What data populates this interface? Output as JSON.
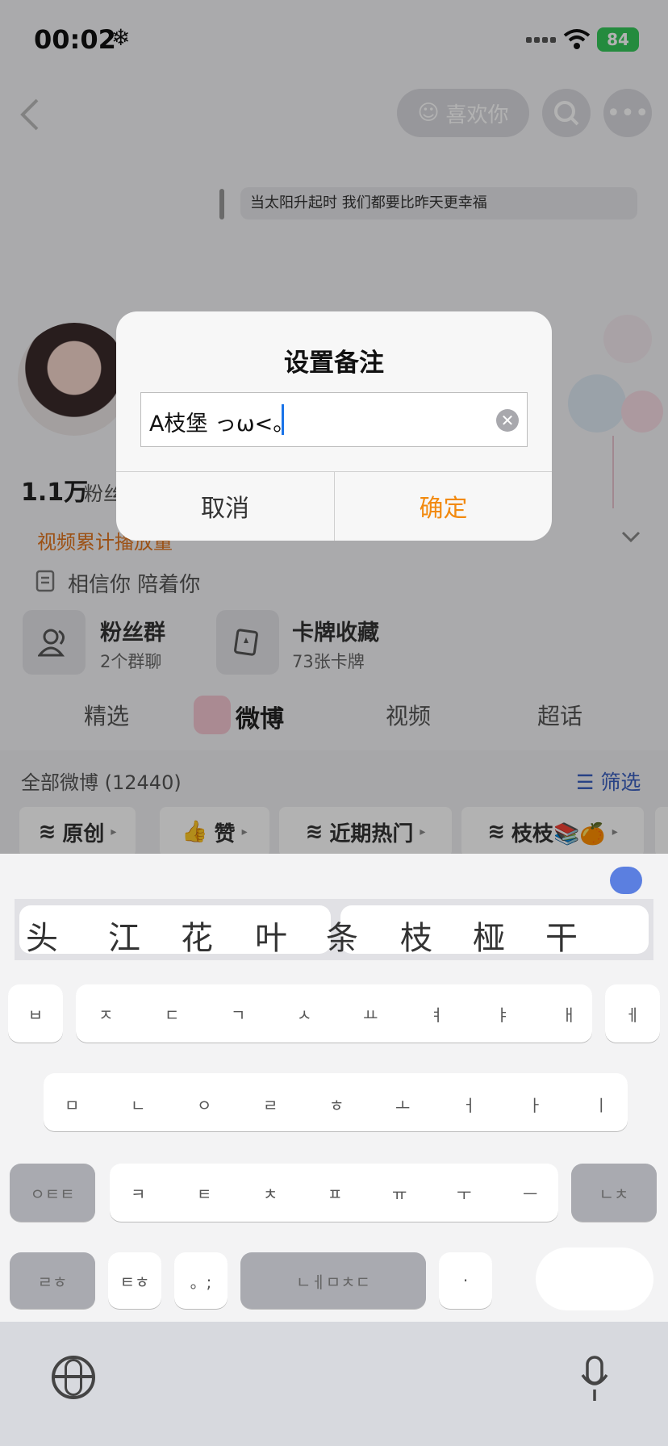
{
  "status_bar": {
    "time": "00:02",
    "weather_icon": "❄",
    "battery": "84"
  },
  "profile": {
    "like_label": "喜欢你",
    "slogan": "当太阳升起时  我们都要比昨天更幸福",
    "fans_count": "1.1万",
    "fans_label": "粉丝",
    "plays_text": "视频累计播放量",
    "motto": "相信你 陪着你",
    "cards": [
      {
        "title": "粉丝群",
        "sub": "2个群聊"
      },
      {
        "title": "卡牌收藏",
        "sub": "73张卡牌"
      }
    ],
    "tabs": [
      "精选",
      "微博",
      "视频",
      "超话"
    ],
    "all_weibo": "全部微博 (12440)",
    "filter": "筛选",
    "chips": [
      "原创",
      "赞",
      "近期热门",
      "枝枝📚🍊"
    ]
  },
  "dialog": {
    "title": "设置备注",
    "input_value": "A枝堡 っω<。",
    "cancel": "取消",
    "confirm": "确定"
  },
  "keyboard": {
    "candidates": [
      "头",
      "江",
      "花",
      "叶",
      "条",
      "枝",
      "桠",
      "干"
    ],
    "row1": [
      "ㅂ",
      "ㅈ",
      "ㄷ",
      "ㄱ",
      "ㅅ",
      "ㅛ",
      "ㅕ",
      "ㅑ",
      "ㅐ",
      "ㅔ"
    ],
    "row2": [
      "ㅁ",
      "ㄴ",
      "ㅇ",
      "ㄹ",
      "ㅎ",
      "ㅗ",
      "ㅓ",
      "ㅏ",
      "ㅣ"
    ],
    "row3_left": "ㅇㅌㅌ",
    "row3": [
      "ㅋ",
      "ㅌ",
      "ㅊ",
      "ㅍ",
      "ㅠ",
      "ㅜ",
      "ㅡ"
    ],
    "row3_right": "ㄴㅊ",
    "row4": [
      "ㄹㅎ",
      "ㅌㅎ",
      "。;",
      "ㄴㅔㅁㅊㄷ",
      "·"
    ]
  }
}
